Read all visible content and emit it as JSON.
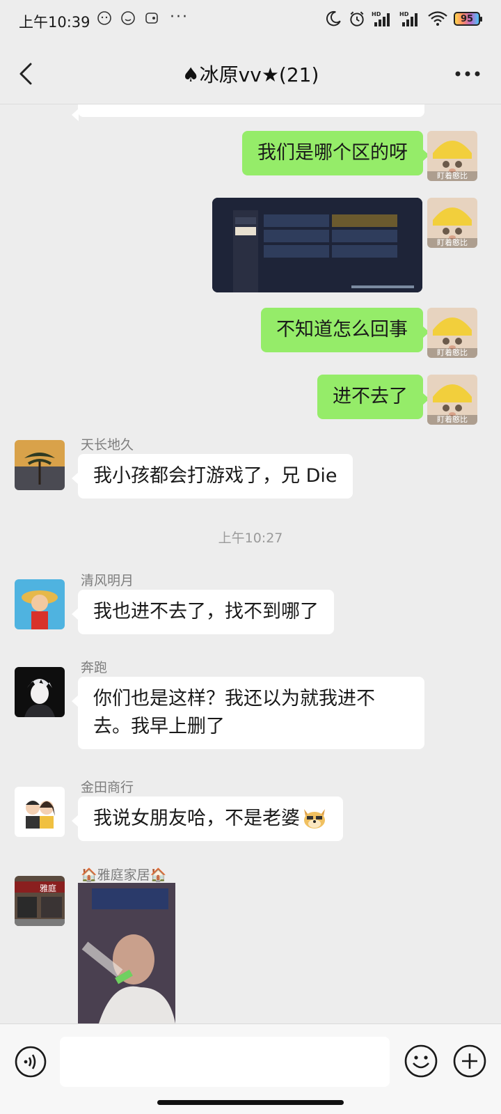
{
  "status_bar": {
    "time": "上午10:39",
    "dots": "···",
    "battery": "95"
  },
  "header": {
    "title": "♠冰原vv★(21)"
  },
  "messages": [
    {
      "side": "me",
      "type": "text",
      "text": "我们是哪个区的呀"
    },
    {
      "side": "me",
      "type": "image"
    },
    {
      "side": "me",
      "type": "text",
      "text": "不知道怎么回事"
    },
    {
      "side": "me",
      "type": "text",
      "text": "进不去了"
    },
    {
      "side": "other",
      "type": "text",
      "sender": "天长地久",
      "text": "我小孩都会打游戏了，兄 Die"
    },
    {
      "type": "time",
      "text": "上午10:27"
    },
    {
      "side": "other",
      "type": "text",
      "sender": "清风明月",
      "text": "我也进不去了，找不到哪了"
    },
    {
      "side": "other",
      "type": "text",
      "sender": "奔跑",
      "text": "你们也是这样？我还以为就我进不去。我早上删了"
    },
    {
      "side": "other",
      "type": "text",
      "sender": "金田商行",
      "text": "我说女朋友哈，不是老婆"
    },
    {
      "side": "other",
      "type": "image",
      "sender": "🏠雅庭家居🏠"
    }
  ],
  "my_avatar_caption": "盯着憨比",
  "shop_sign_text": "雅庭",
  "input": {
    "placeholder": ""
  },
  "icons": {
    "back": "back-chevron-icon",
    "more": "more-dots-icon",
    "voice": "voice-input-icon",
    "emoji": "emoji-icon",
    "plus": "plus-icon"
  },
  "colors": {
    "my_bubble": "#95ec69",
    "other_bubble": "#ffffff",
    "background": "#ededed"
  }
}
